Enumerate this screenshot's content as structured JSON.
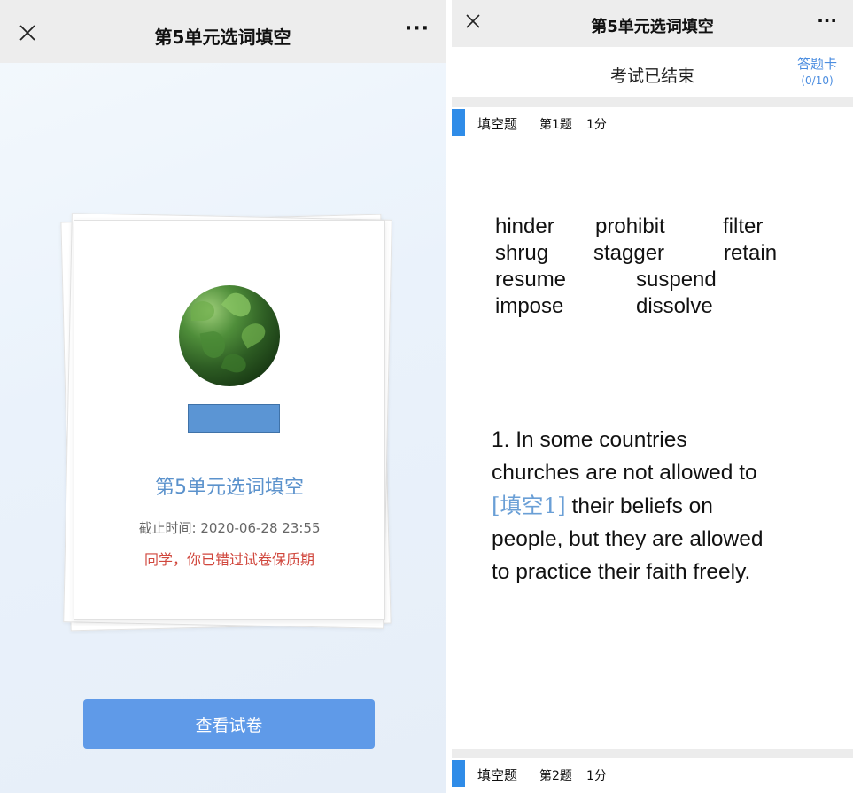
{
  "left": {
    "window_title": "第5单元选词填空",
    "more_label": "···",
    "card": {
      "title": "第5单元选词填空",
      "deadline_label": "截止时间:",
      "deadline_value": "2020-06-28 23:55",
      "warning": "同学，你已错过试卷保质期"
    },
    "view_button_label": "查看试卷"
  },
  "right": {
    "window_title": "第5单元选词填空",
    "more_label": "···",
    "status": "考试已结束",
    "answer_card": {
      "label": "答题卡",
      "count": "(0/10)"
    },
    "questions": [
      {
        "type": "填空题",
        "number": "第1题",
        "points": "1分"
      },
      {
        "type": "填空题",
        "number": "第2题",
        "points": "1分"
      }
    ],
    "word_bank": [
      [
        "hinder",
        "prohibit",
        "filter"
      ],
      [
        "shrug",
        "stagger",
        "retain"
      ],
      [
        "resume",
        "suspend"
      ],
      [
        "impose",
        "dissolve"
      ]
    ],
    "question_text": {
      "line1": "1. In some countries",
      "line2": "churches are not allowed to",
      "blank": "[填空1]",
      "line3_rest": "their beliefs on",
      "line4": "people, but they are allowed",
      "line5": "to practice their faith freely."
    }
  },
  "colors": {
    "accent_blue": "#5f9ae8",
    "link_blue": "#4b8de0",
    "question_bar": "#2f8ce8",
    "warning_red": "#d0463c",
    "card_title_blue": "#5b92cc"
  },
  "icons": {
    "close": "close-icon",
    "more": "more-icon"
  }
}
